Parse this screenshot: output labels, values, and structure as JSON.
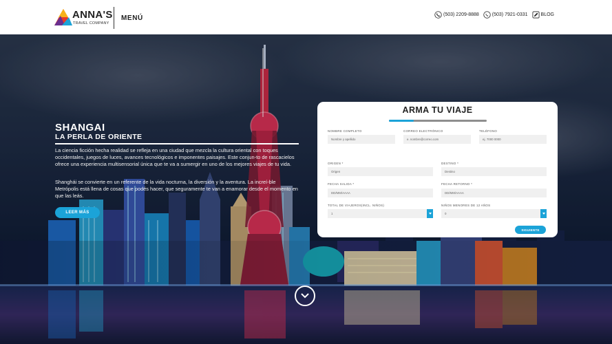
{
  "header": {
    "logo": {
      "name": "ANNA'S",
      "sub": "TRAVEL COMPANY"
    },
    "menu_label": "MENÚ",
    "contacts": [
      {
        "icon": "phone-icon",
        "text": "(503) 2209-8888"
      },
      {
        "icon": "whatsapp-icon",
        "text": "(503) 7921-0331"
      },
      {
        "icon": "blog-icon",
        "text": "BLOG"
      }
    ]
  },
  "hero": {
    "title": "SHANGAI",
    "subtitle": "LA PERLA DE ORIENTE",
    "paragraph1": "La ciencia ficción hecha realidad se refleja en una ciudad que mezcla la cultura oriental con toques occidentales, juegos de luces, avances tecnológicos e imponentes paisajes. Este conjun-to de rascacielos ofrece una experiencia multisensorial única que te va a sumergir en uno de los mejores viajes de tu vida.",
    "paragraph2": "Shanghái se convierte en un referente de la vida nocturna, la diversión y la aventura. La increí-ble Metrópolis está llena de cosas que podés hacer, que seguramente te van a enamorar desde el momento en que las leás.",
    "read_more": "LEER MÁS"
  },
  "form": {
    "title": "ARMA TU VIAJE",
    "progress": 0.25,
    "fields": {
      "nombre": {
        "label": "NOMBRE COMPLETO",
        "placeholder": "Nombre y apellido"
      },
      "correo": {
        "label": "CORREO ELECTRÓNICO",
        "placeholder": "e. nombre@correo.com"
      },
      "telefono": {
        "label": "TELÉFONO",
        "placeholder": "ej. 7000 0000"
      },
      "origen": {
        "label": "ORIGEN *",
        "placeholder": "Origen"
      },
      "destino": {
        "label": "DESTINO *",
        "placeholder": "Destino"
      },
      "salida": {
        "label": "FECHA SALIDA *",
        "placeholder": "DD/MM/AAAA"
      },
      "retorno": {
        "label": "FECHA RETORNO *",
        "placeholder": "DD/MM/AAAA"
      },
      "viajeros": {
        "label": "TOTAL DE VIAJEROS(INCL. NIÑOS)",
        "value": "1"
      },
      "ninos": {
        "label": "NIÑOS MENORES DE 12 AÑOS",
        "value": "0"
      }
    },
    "next": "SIGUIENTE"
  },
  "colors": {
    "accent": "#1ba3d8",
    "header_bg": "#ffffff"
  }
}
